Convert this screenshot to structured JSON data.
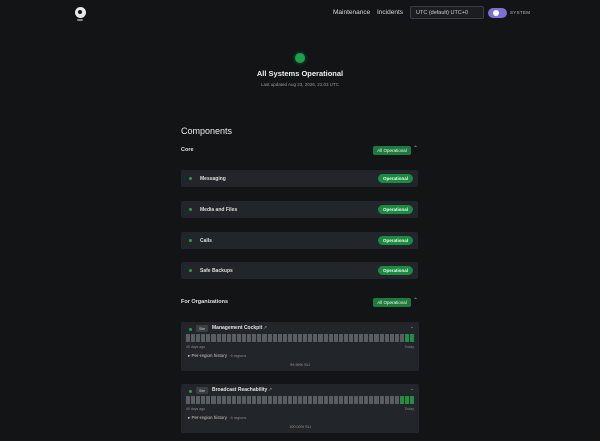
{
  "header": {
    "nav": [
      "Maintenance",
      "Incidents"
    ],
    "timezone": "UTC (default)   UTC+0",
    "theme_label": "SYSTEM"
  },
  "status": {
    "title": "All Systems Operational",
    "updated": "Last updated Aug 23, 2026, 21:03 UTC"
  },
  "components": {
    "heading": "Components",
    "groups": [
      {
        "title": "Core",
        "badge": "All Operational",
        "items": [
          {
            "name": "Messaging",
            "status": "Operational"
          },
          {
            "name": "Media and Files",
            "status": "Operational"
          },
          {
            "name": "Calls",
            "status": "Operational"
          },
          {
            "name": "Safe Backups",
            "status": "Operational"
          }
        ]
      },
      {
        "title": "For Organizations",
        "badge": "All Operational",
        "items": [
          {
            "tag": "Site",
            "name": "Management Cockpit",
            "ago": "45 days ago",
            "today": "Today",
            "region": "Per-region history",
            "region_count": "· 6 regions",
            "uptime": "99.99% SLI",
            "green_days": 2
          },
          {
            "tag": "Site",
            "name": "Broadcast Reachability",
            "ago": "45 days ago",
            "today": "Today",
            "region": "Per-region history",
            "region_count": "· 6 regions",
            "uptime": "100.00% SLI",
            "green_days": 3
          }
        ]
      }
    ]
  },
  "colors": {
    "background": "#131416",
    "card": "#222529",
    "operational": "#1c8a43",
    "accent": "#7c6fd6"
  }
}
